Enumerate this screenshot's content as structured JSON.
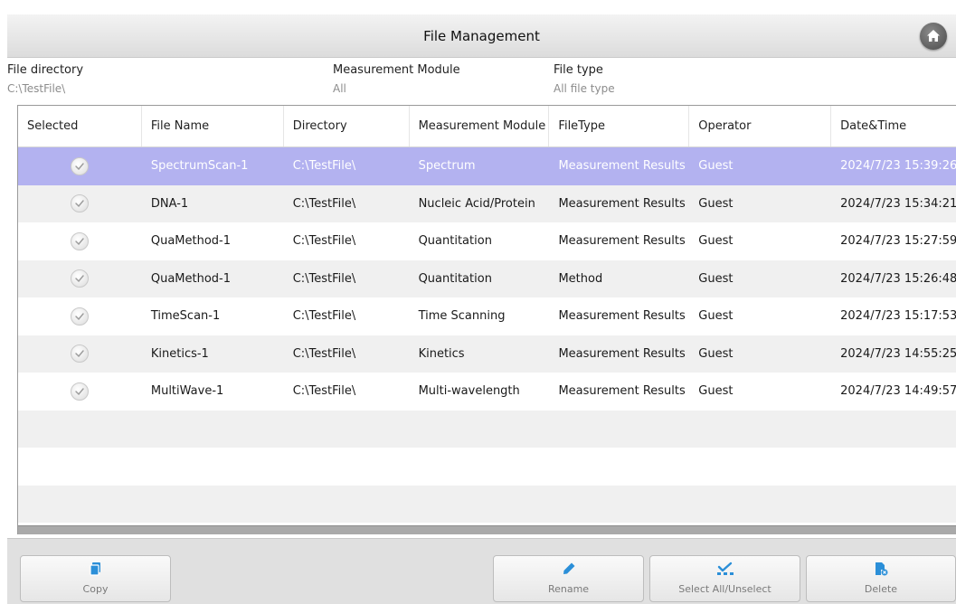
{
  "header": {
    "title": "File Management"
  },
  "filters": {
    "directory": {
      "label": "File directory",
      "value": "C:\\TestFile\\"
    },
    "module": {
      "label": "Measurement Module",
      "value": "All"
    },
    "file_type": {
      "label": "File type",
      "value": "All file type"
    }
  },
  "table": {
    "columns": [
      "Selected",
      "File Name",
      "Directory",
      "Measurement Module",
      "FileType",
      "Operator",
      "Date&Time"
    ],
    "rows": [
      {
        "name": "SpectrumScan-1",
        "dir": "C:\\TestFile\\",
        "module": "Spectrum",
        "type": "Measurement Results",
        "operator": "Guest",
        "datetime": "2024/7/23 15:39:26",
        "selected": true
      },
      {
        "name": "DNA-1",
        "dir": "C:\\TestFile\\",
        "module": "Nucleic Acid/Protein",
        "type": "Measurement Results",
        "operator": "Guest",
        "datetime": "2024/7/23 15:34:21"
      },
      {
        "name": "QuaMethod-1",
        "dir": "C:\\TestFile\\",
        "module": "Quantitation",
        "type": "Measurement Results",
        "operator": "Guest",
        "datetime": "2024/7/23 15:27:59"
      },
      {
        "name": "QuaMethod-1",
        "dir": "C:\\TestFile\\",
        "module": "Quantitation",
        "type": "Method",
        "operator": "Guest",
        "datetime": "2024/7/23 15:26:48"
      },
      {
        "name": "TimeScan-1",
        "dir": "C:\\TestFile\\",
        "module": "Time Scanning",
        "type": "Measurement Results",
        "operator": "Guest",
        "datetime": "2024/7/23 15:17:53"
      },
      {
        "name": "Kinetics-1",
        "dir": "C:\\TestFile\\",
        "module": "Kinetics",
        "type": "Measurement Results",
        "operator": "Guest",
        "datetime": "2024/7/23 14:55:25"
      },
      {
        "name": "MultiWave-1",
        "dir": "C:\\TestFile\\",
        "module": "Multi-wavelength",
        "type": "Measurement Results",
        "operator": "Guest",
        "datetime": "2024/7/23 14:49:57"
      }
    ]
  },
  "toolbar": {
    "copy": "Copy",
    "rename": "Rename",
    "select_all": "Select All/Unselect",
    "delete": "Delete"
  },
  "colors": {
    "selected_row": "#b3b2f0",
    "icon_blue": "#2b8fd8"
  },
  "icons": {
    "home": "home-icon",
    "check": "check-icon",
    "copy": "copy-icon",
    "rename": "pencil-icon",
    "select_all": "select-all-icon",
    "delete": "delete-file-icon"
  }
}
